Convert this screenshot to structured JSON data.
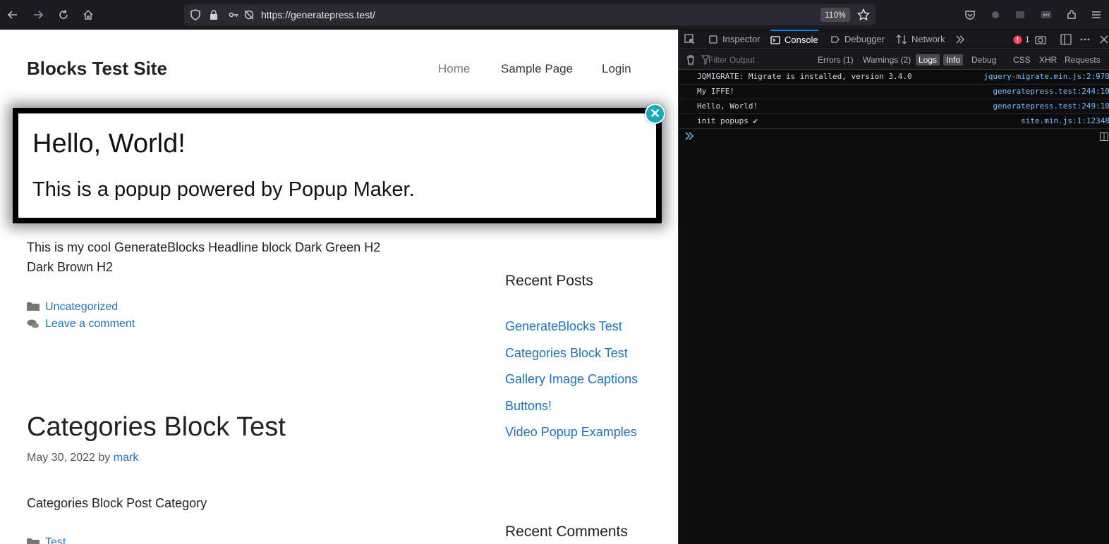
{
  "browser": {
    "url": "https://generatepress.test/",
    "zoom": "110%"
  },
  "site": {
    "title": "Blocks Test Site",
    "nav": [
      "Home",
      "Sample Page",
      "Login"
    ]
  },
  "popup": {
    "heading": "Hello, World!",
    "body": "This is a popup powered by Popup Maker."
  },
  "post1": {
    "text_line1": "This is my cool GenerateBlocks Headline block Dark Green H2",
    "text_line2": "Dark Brown H2",
    "category": "Uncategorized",
    "comment_link": "Leave a comment"
  },
  "post2": {
    "title": "Categories Block Test",
    "date": "May 30, 2022",
    "by": "by",
    "author": "mark",
    "text": "Categories Block Post Category",
    "category": "Test"
  },
  "sidebar": {
    "recent_posts_title": "Recent Posts",
    "recent_posts": [
      "GenerateBlocks Test",
      "Categories Block Test",
      "Gallery Image Captions",
      "Buttons!",
      "Video Popup Examples"
    ],
    "recent_comments_title": "Recent Comments"
  },
  "devtools": {
    "tabs": [
      "Inspector",
      "Console",
      "Debugger",
      "Network"
    ],
    "error_count": "1",
    "filter_placeholder": "Filter Output",
    "filters": [
      "Errors (1)",
      "Warnings (2)",
      "Logs",
      "Info",
      "Debug",
      "CSS",
      "XHR",
      "Requests"
    ],
    "logs": [
      {
        "msg": "JQMIGRATE: Migrate is installed, version 3.4.0",
        "src": "jquery-migrate.min.js:2:970"
      },
      {
        "msg": "My IFFE!",
        "src": "generatepress.test:244:10"
      },
      {
        "msg": "Hello, World!",
        "src": "generatepress.test:249:10"
      },
      {
        "msg": "init popups ✔",
        "src": "site.min.js:1:12348"
      }
    ]
  },
  "colors": {
    "link": "#1e73be",
    "popup_close": "#1aa9bd",
    "devtools_bg": "#0c0c0d",
    "devtools_accent": "#0a84ff"
  }
}
